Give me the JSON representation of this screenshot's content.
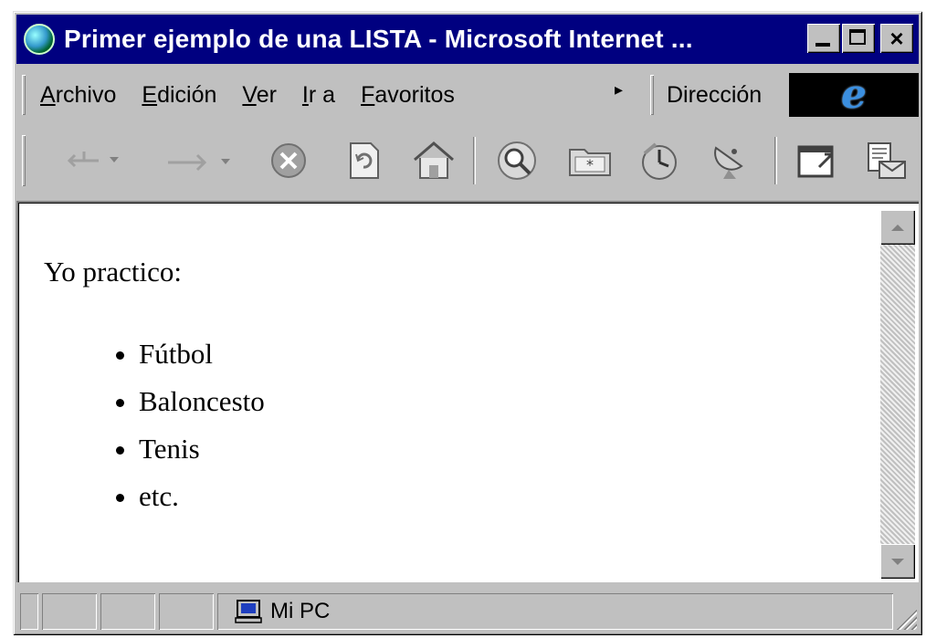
{
  "window": {
    "title": "Primer ejemplo de una LISTA - Microsoft Internet ...",
    "controls": {
      "minimize": "minimize-icon",
      "maximize": "maximize-icon",
      "close": "×"
    }
  },
  "menu": {
    "items": [
      {
        "label_first": "A",
        "label_rest": "rchivo"
      },
      {
        "label_first": "E",
        "label_rest": "dición"
      },
      {
        "label_first": "V",
        "label_rest": "er"
      },
      {
        "label_first": "I",
        "label_rest": "r a"
      },
      {
        "label_first": "F",
        "label_rest": "avoritos"
      }
    ],
    "more": "▸",
    "address_label": "Dirección"
  },
  "toolbar": {
    "buttons": [
      "back-icon",
      "forward-icon",
      "stop-icon",
      "refresh-icon",
      "home-icon",
      "search-icon",
      "favorites-icon",
      "history-icon",
      "channels-icon",
      "fullscreen-icon",
      "mail-icon"
    ]
  },
  "page": {
    "intro": "Yo practico:",
    "items": [
      "Fútbol",
      "Baloncesto",
      "Tenis",
      "etc."
    ]
  },
  "status": {
    "zone": "Mi PC"
  },
  "colors": {
    "titlebar": "#000080",
    "chrome": "#c0c0c0",
    "ie_logo_bg": "#000000",
    "ie_logo_e": "#3b8fe0"
  }
}
